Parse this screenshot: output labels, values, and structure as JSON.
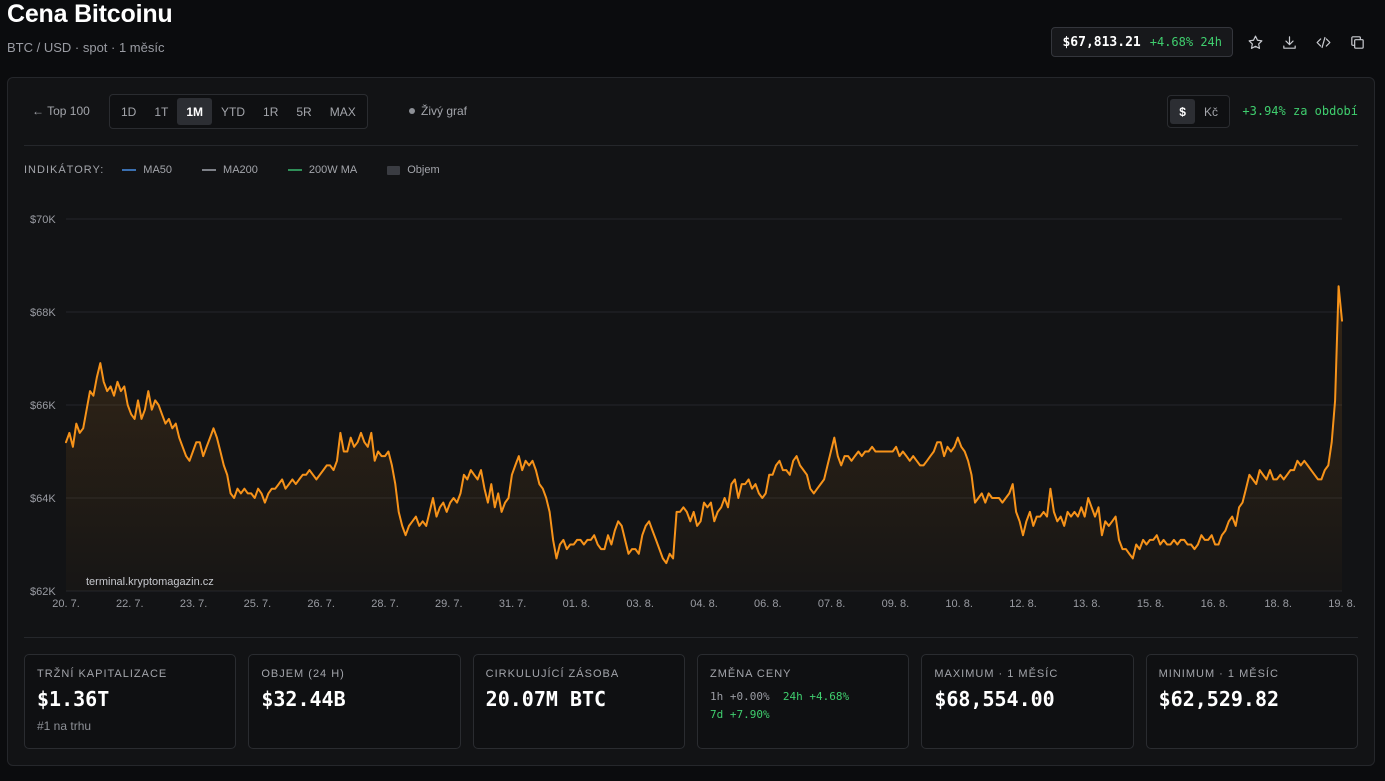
{
  "header": {
    "title": "Cena Bitcoinu",
    "subtitle": "BTC / USD · spot · 1 měsíc",
    "price": "$67,813.21",
    "change_24h": "+4.68% 24h"
  },
  "toolbar": {
    "back_label": "← Top 100",
    "ranges": [
      "1D",
      "1T",
      "1M",
      "YTD",
      "1R",
      "5R",
      "MAX"
    ],
    "active_range": "1M",
    "live_label": "Živý graf",
    "currencies": [
      "$",
      "Kč"
    ],
    "active_currency": "$",
    "period_change": "+3.94% za období"
  },
  "indicators": {
    "label": "INDIKÁTORY:",
    "items": [
      {
        "name": "MA50",
        "color": "#3a6fb0"
      },
      {
        "name": "MA200",
        "color": "#7d8087"
      },
      {
        "name": "200W MA",
        "color": "#2f8f58"
      },
      {
        "name": "Objem",
        "color": "#3a3c42"
      }
    ]
  },
  "watermark": "terminal.kryptomagazin.cz",
  "chart_data": {
    "type": "area",
    "ylim": [
      62000,
      70000
    ],
    "yticks": [
      "$70K",
      "$68K",
      "$66K",
      "$64K",
      "$62K"
    ],
    "ytick_values": [
      70000,
      68000,
      66000,
      64000,
      62000
    ],
    "xticks": [
      "20. 7.",
      "22. 7.",
      "23. 7.",
      "25. 7.",
      "26. 7.",
      "28. 7.",
      "29. 7.",
      "31. 7.",
      "01. 8.",
      "03. 8.",
      "04. 8.",
      "06. 8.",
      "07. 8.",
      "09. 8.",
      "10. 8.",
      "12. 8.",
      "13. 8.",
      "15. 8.",
      "16. 8.",
      "18. 8.",
      "19. 8."
    ],
    "line_color": "#f7931a",
    "grid": true,
    "values": [
      65200,
      65400,
      65100,
      65600,
      65400,
      65500,
      65900,
      66300,
      66200,
      66600,
      66900,
      66500,
      66300,
      66400,
      66200,
      66500,
      66300,
      66400,
      66000,
      65800,
      65700,
      66100,
      65700,
      65900,
      66300,
      65900,
      66100,
      66000,
      65800,
      65600,
      65700,
      65500,
      65600,
      65300,
      65100,
      64900,
      64800,
      65000,
      65200,
      65200,
      64900,
      65100,
      65300,
      65500,
      65300,
      65000,
      64700,
      64500,
      64100,
      64000,
      64200,
      64100,
      64200,
      64100,
      64100,
      64000,
      64200,
      64100,
      63900,
      64100,
      64200,
      64200,
      64300,
      64400,
      64200,
      64300,
      64400,
      64300,
      64400,
      64500,
      64500,
      64600,
      64500,
      64400,
      64500,
      64600,
      64700,
      64700,
      64600,
      64800,
      65400,
      65000,
      65000,
      65300,
      65100,
      65200,
      65400,
      65200,
      65100,
      65400,
      64800,
      65000,
      64900,
      64900,
      65000,
      64700,
      64300,
      63700,
      63400,
      63200,
      63400,
      63500,
      63600,
      63400,
      63500,
      63400,
      63700,
      64000,
      63600,
      63800,
      63900,
      63700,
      63900,
      64000,
      63900,
      64100,
      64500,
      64400,
      64600,
      64500,
      64400,
      64600,
      64200,
      63900,
      64300,
      63800,
      64100,
      63700,
      63900,
      64000,
      64500,
      64700,
      64900,
      64600,
      64800,
      64700,
      64800,
      64600,
      64300,
      64200,
      64000,
      63700,
      63100,
      62700,
      63000,
      63100,
      62900,
      63000,
      63000,
      63100,
      63100,
      63000,
      63100,
      63100,
      63200,
      63000,
      62900,
      62900,
      63200,
      63000,
      63300,
      63500,
      63400,
      63100,
      62800,
      62900,
      62900,
      62800,
      63200,
      63400,
      63500,
      63300,
      63100,
      62900,
      62700,
      62600,
      62800,
      62700,
      63700,
      63700,
      63800,
      63700,
      63500,
      63700,
      63400,
      63500,
      63900,
      63800,
      63900,
      63500,
      63700,
      63800,
      64000,
      63800,
      64300,
      64400,
      64000,
      64300,
      64300,
      64400,
      64200,
      64300,
      64100,
      64000,
      64100,
      64500,
      64500,
      64700,
      64800,
      64600,
      64600,
      64500,
      64800,
      64900,
      64700,
      64600,
      64500,
      64200,
      64100,
      64200,
      64300,
      64400,
      64700,
      65000,
      65300,
      64900,
      64700,
      64900,
      64900,
      64800,
      64900,
      65000,
      64900,
      65000,
      65000,
      65100,
      65000,
      65000,
      65000,
      65000,
      65000,
      65000,
      65100,
      64900,
      65000,
      64900,
      64800,
      64900,
      64800,
      64700,
      64700,
      64800,
      64900,
      65000,
      65200,
      65200,
      64900,
      65100,
      65000,
      65100,
      65300,
      65100,
      65000,
      64800,
      64500,
      63900,
      64000,
      64100,
      63900,
      64100,
      64000,
      64000,
      64000,
      63900,
      64000,
      64100,
      64300,
      63700,
      63500,
      63200,
      63500,
      63700,
      63400,
      63600,
      63600,
      63700,
      63600,
      64200,
      63700,
      63500,
      63600,
      63400,
      63700,
      63600,
      63700,
      63600,
      63800,
      63600,
      64000,
      63800,
      63600,
      63800,
      63200,
      63500,
      63400,
      63500,
      63600,
      63100,
      62900,
      62900,
      62800,
      62700,
      63000,
      62900,
      63100,
      63000,
      63100,
      63100,
      63200,
      63000,
      63100,
      63000,
      63000,
      63100,
      63000,
      63100,
      63100,
      63000,
      63000,
      62900,
      63000,
      63200,
      63100,
      63100,
      63200,
      63000,
      63000,
      63200,
      63300,
      63500,
      63600,
      63400,
      63800,
      63900,
      64200,
      64500,
      64400,
      64300,
      64600,
      64500,
      64400,
      64600,
      64400,
      64400,
      64500,
      64400,
      64500,
      64600,
      64600,
      64800,
      64700,
      64800,
      64700,
      64600,
      64500,
      64400,
      64400,
      64600,
      64700,
      65200,
      66100,
      68554,
      67813
    ]
  },
  "stats": [
    {
      "label": "TRŽNÍ KAPITALIZACE",
      "value": "$1.36T",
      "note": "#1 na trhu"
    },
    {
      "label": "OBJEM (24 H)",
      "value": "$32.44B"
    },
    {
      "label": "CIRKULUJÍCÍ ZÁSOBA",
      "value": "20.07M BTC"
    },
    {
      "label": "ZMĚNA CENY",
      "h1": "1h +0.00%",
      "h24": "24h +4.68%",
      "d7": "7d +7.90%"
    },
    {
      "label": "MAXIMUM · 1 MĚSÍC",
      "value": "$68,554.00"
    },
    {
      "label": "MINIMUM · 1 MĚSÍC",
      "value": "$62,529.82"
    }
  ]
}
